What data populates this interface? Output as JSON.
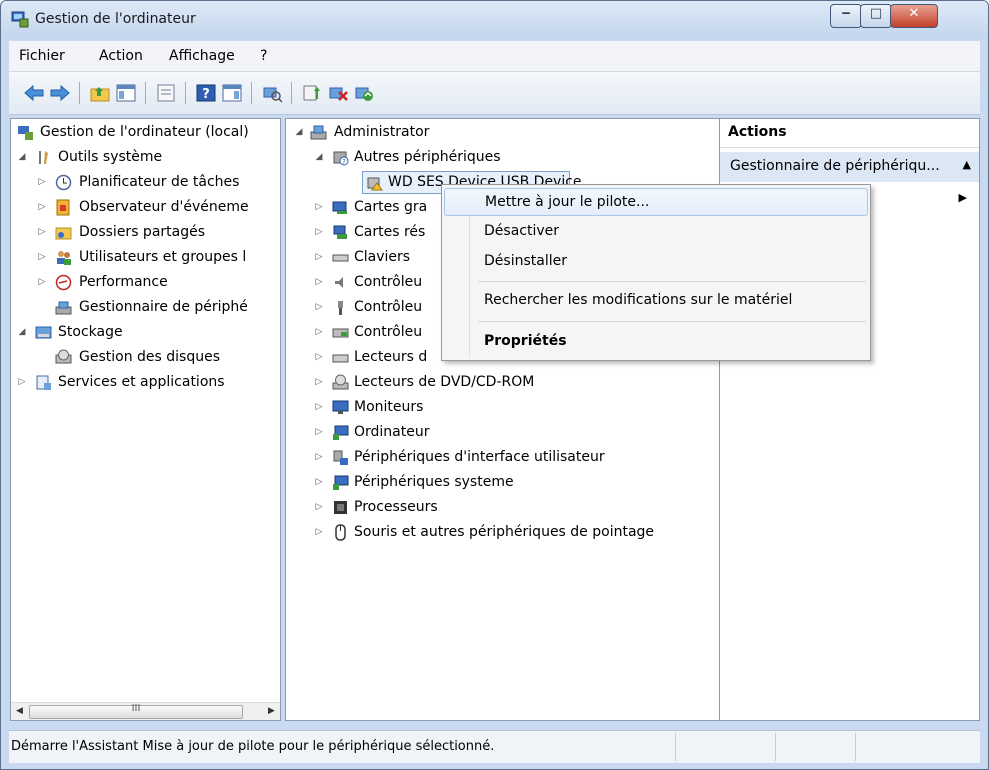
{
  "window": {
    "title": "Gestion de l'ordinateur"
  },
  "menu": [
    "Fichier",
    "Action",
    "Affichage",
    "?"
  ],
  "toolbar_icons": [
    "back-arrow-icon",
    "forward-arrow-icon",
    "up-folder-icon",
    "show-hide-tree-icon",
    "export-list-icon",
    "help-icon",
    "show-hide-action-pane-icon",
    "scan-hardware-icon",
    "update-driver-icon",
    "uninstall-device-icon",
    "disable-device-icon"
  ],
  "left_tree": {
    "root": "Gestion de l'ordinateur (local)",
    "system_tools": "Outils système",
    "task_scheduler": "Planificateur de tâches",
    "event_viewer": "Observateur d'événeme",
    "shared_folders": "Dossiers partagés",
    "local_users": "Utilisateurs et groupes l",
    "performance": "Performance",
    "device_manager": "Gestionnaire de périphé",
    "storage": "Stockage",
    "disk_management": "Gestion des disques",
    "services_apps": "Services et applications",
    "scroll_grip": "III"
  },
  "device_tree": {
    "root": "Administrator",
    "other_devices": "Autres périphériques",
    "selected_device": "WD SES Device USB Device",
    "items": [
      "Cartes gra",
      "Cartes rés",
      "Claviers",
      "Contrôleu",
      "Contrôleu",
      "Contrôleu",
      "Lecteurs d",
      "Lecteurs de DVD/CD-ROM",
      "Moniteurs",
      "Ordinateur",
      "Périphériques d'interface utilisateur",
      "Périphériques systeme",
      "Processeurs",
      "Souris et autres périphériques de pointage"
    ]
  },
  "context_menu": {
    "update_driver": "Mettre à jour le pilote...",
    "disable": "Désactiver",
    "uninstall": "Désinstaller",
    "scan": "Rechercher les modifications sur le matériel",
    "properties": "Propriétés"
  },
  "actions_pane": {
    "title": "Actions",
    "section": "Gestionnaire de périphériqu...",
    "collapse_glyph": "▲",
    "more_glyph": "▶"
  },
  "status": "Démarre l'Assistant Mise à jour de pilote pour le périphérique sélectionné.",
  "colors": {
    "accent": "#dbe7f5",
    "selection_border": "#7da2ce",
    "close_button": "#c2402a"
  }
}
